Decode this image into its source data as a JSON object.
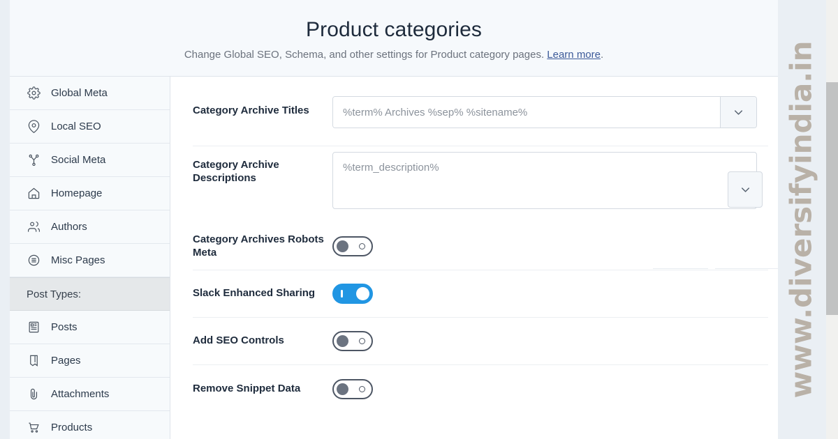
{
  "header": {
    "title": "Product categories",
    "subtitle_text": "Change Global SEO, Schema, and other settings for Product category pages.",
    "subtitle_link": "Learn more",
    "subtitle_suffix": "."
  },
  "sidebar": {
    "items": [
      {
        "label": "Global Meta",
        "icon": "gear-icon"
      },
      {
        "label": "Local SEO",
        "icon": "map-pin-icon"
      },
      {
        "label": "Social Meta",
        "icon": "share-nodes-icon"
      },
      {
        "label": "Homepage",
        "icon": "home-icon"
      },
      {
        "label": "Authors",
        "icon": "users-icon"
      },
      {
        "label": "Misc Pages",
        "icon": "list-circle-icon"
      }
    ],
    "section_header": "Post Types:",
    "post_type_items": [
      {
        "label": "Posts",
        "icon": "article-icon"
      },
      {
        "label": "Pages",
        "icon": "page-icon"
      },
      {
        "label": "Attachments",
        "icon": "paperclip-icon"
      },
      {
        "label": "Products",
        "icon": "shopping-cart-icon"
      }
    ]
  },
  "settings": {
    "archive_titles": {
      "label": "Category Archive Titles",
      "value": "%term% Archives %sep% %sitename%",
      "placeholder": "%term% Archives %sep% %sitename%",
      "dropdown_icon": "chevron-down-icon"
    },
    "archive_descriptions": {
      "label": "Category Archive Descriptions",
      "value": "%term_description%",
      "placeholder": "%term_description%",
      "dropdown_icon": "chevron-down-icon"
    },
    "robots_meta": {
      "label": "Category Archives Robots Meta",
      "state": "off"
    },
    "slack_sharing": {
      "label": "Slack Enhanced Sharing",
      "state": "on"
    },
    "seo_controls": {
      "label": "Add SEO Controls",
      "state": "off"
    },
    "remove_snippet": {
      "label": "Remove Snippet Data",
      "state": "off"
    }
  },
  "watermark": {
    "text": "www.diversifyindia.in"
  },
  "colors": {
    "accent_blue": "#2196e3",
    "toggle_off_border": "#4d5664",
    "link": "#3c5a99",
    "page_bg": "#eaeff4",
    "watermark": "#b7aea3",
    "scrollbar_thumb": "#c1c2c2"
  }
}
